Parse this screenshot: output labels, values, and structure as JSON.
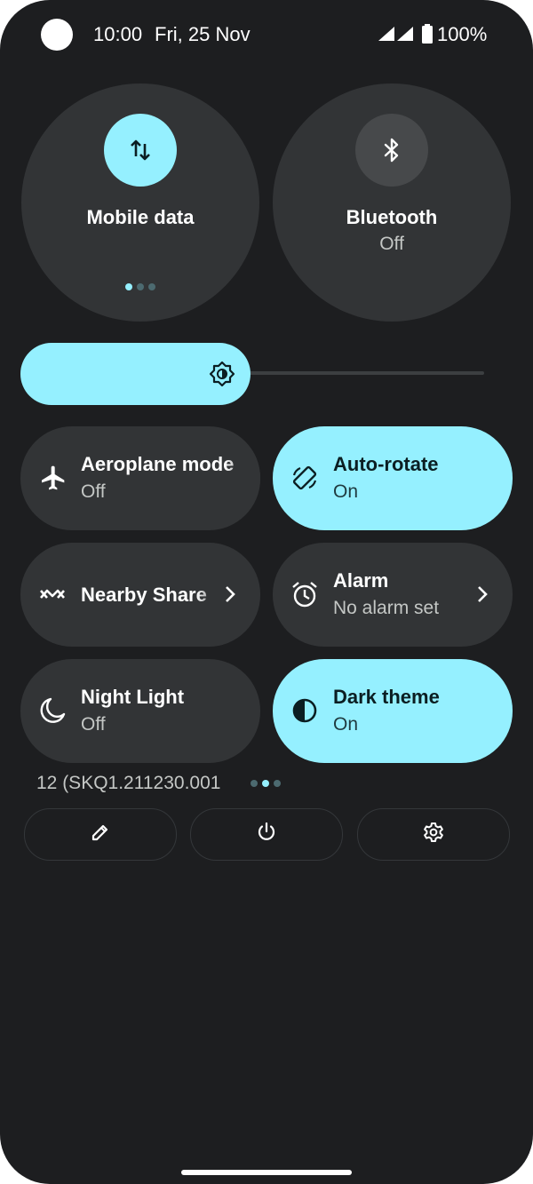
{
  "status_bar": {
    "time": "10:00",
    "date": "Fri, 25 Nov",
    "battery": "100%"
  },
  "big_tiles": [
    {
      "label": "Mobile data",
      "icon": "mobile-data-icon",
      "active": true
    },
    {
      "label": "Bluetooth",
      "sublabel": "Off",
      "icon": "bluetooth-icon",
      "active": false
    }
  ],
  "brightness": {
    "level": 0.45,
    "icon": "brightness-auto-icon"
  },
  "tiles": [
    {
      "label": "Aeroplane mode",
      "sublabel": "Off",
      "icon": "airplane-icon",
      "active": false
    },
    {
      "label": "Auto-rotate",
      "sublabel": "On",
      "icon": "auto-rotate-icon",
      "active": true
    },
    {
      "label": "Nearby Share",
      "icon": "nearby-share-icon",
      "active": false
    },
    {
      "label": "Alarm",
      "sublabel": "No alarm set",
      "icon": "alarm-icon",
      "active": false
    },
    {
      "label": "Night Light",
      "sublabel": "Off",
      "icon": "moon-icon",
      "active": false
    },
    {
      "label": "Dark theme",
      "sublabel": "On",
      "icon": "dark-theme-icon",
      "active": true
    }
  ],
  "build_number": "12 (SKQ1.211230.001",
  "footer": {
    "edit_icon": "pencil-icon",
    "power_icon": "power-icon",
    "settings_icon": "gear-icon"
  },
  "colors": {
    "background": "#1d1e20",
    "tile": "#323436",
    "accent": "#95f0ff",
    "icon_dark": "#0b1e22"
  }
}
